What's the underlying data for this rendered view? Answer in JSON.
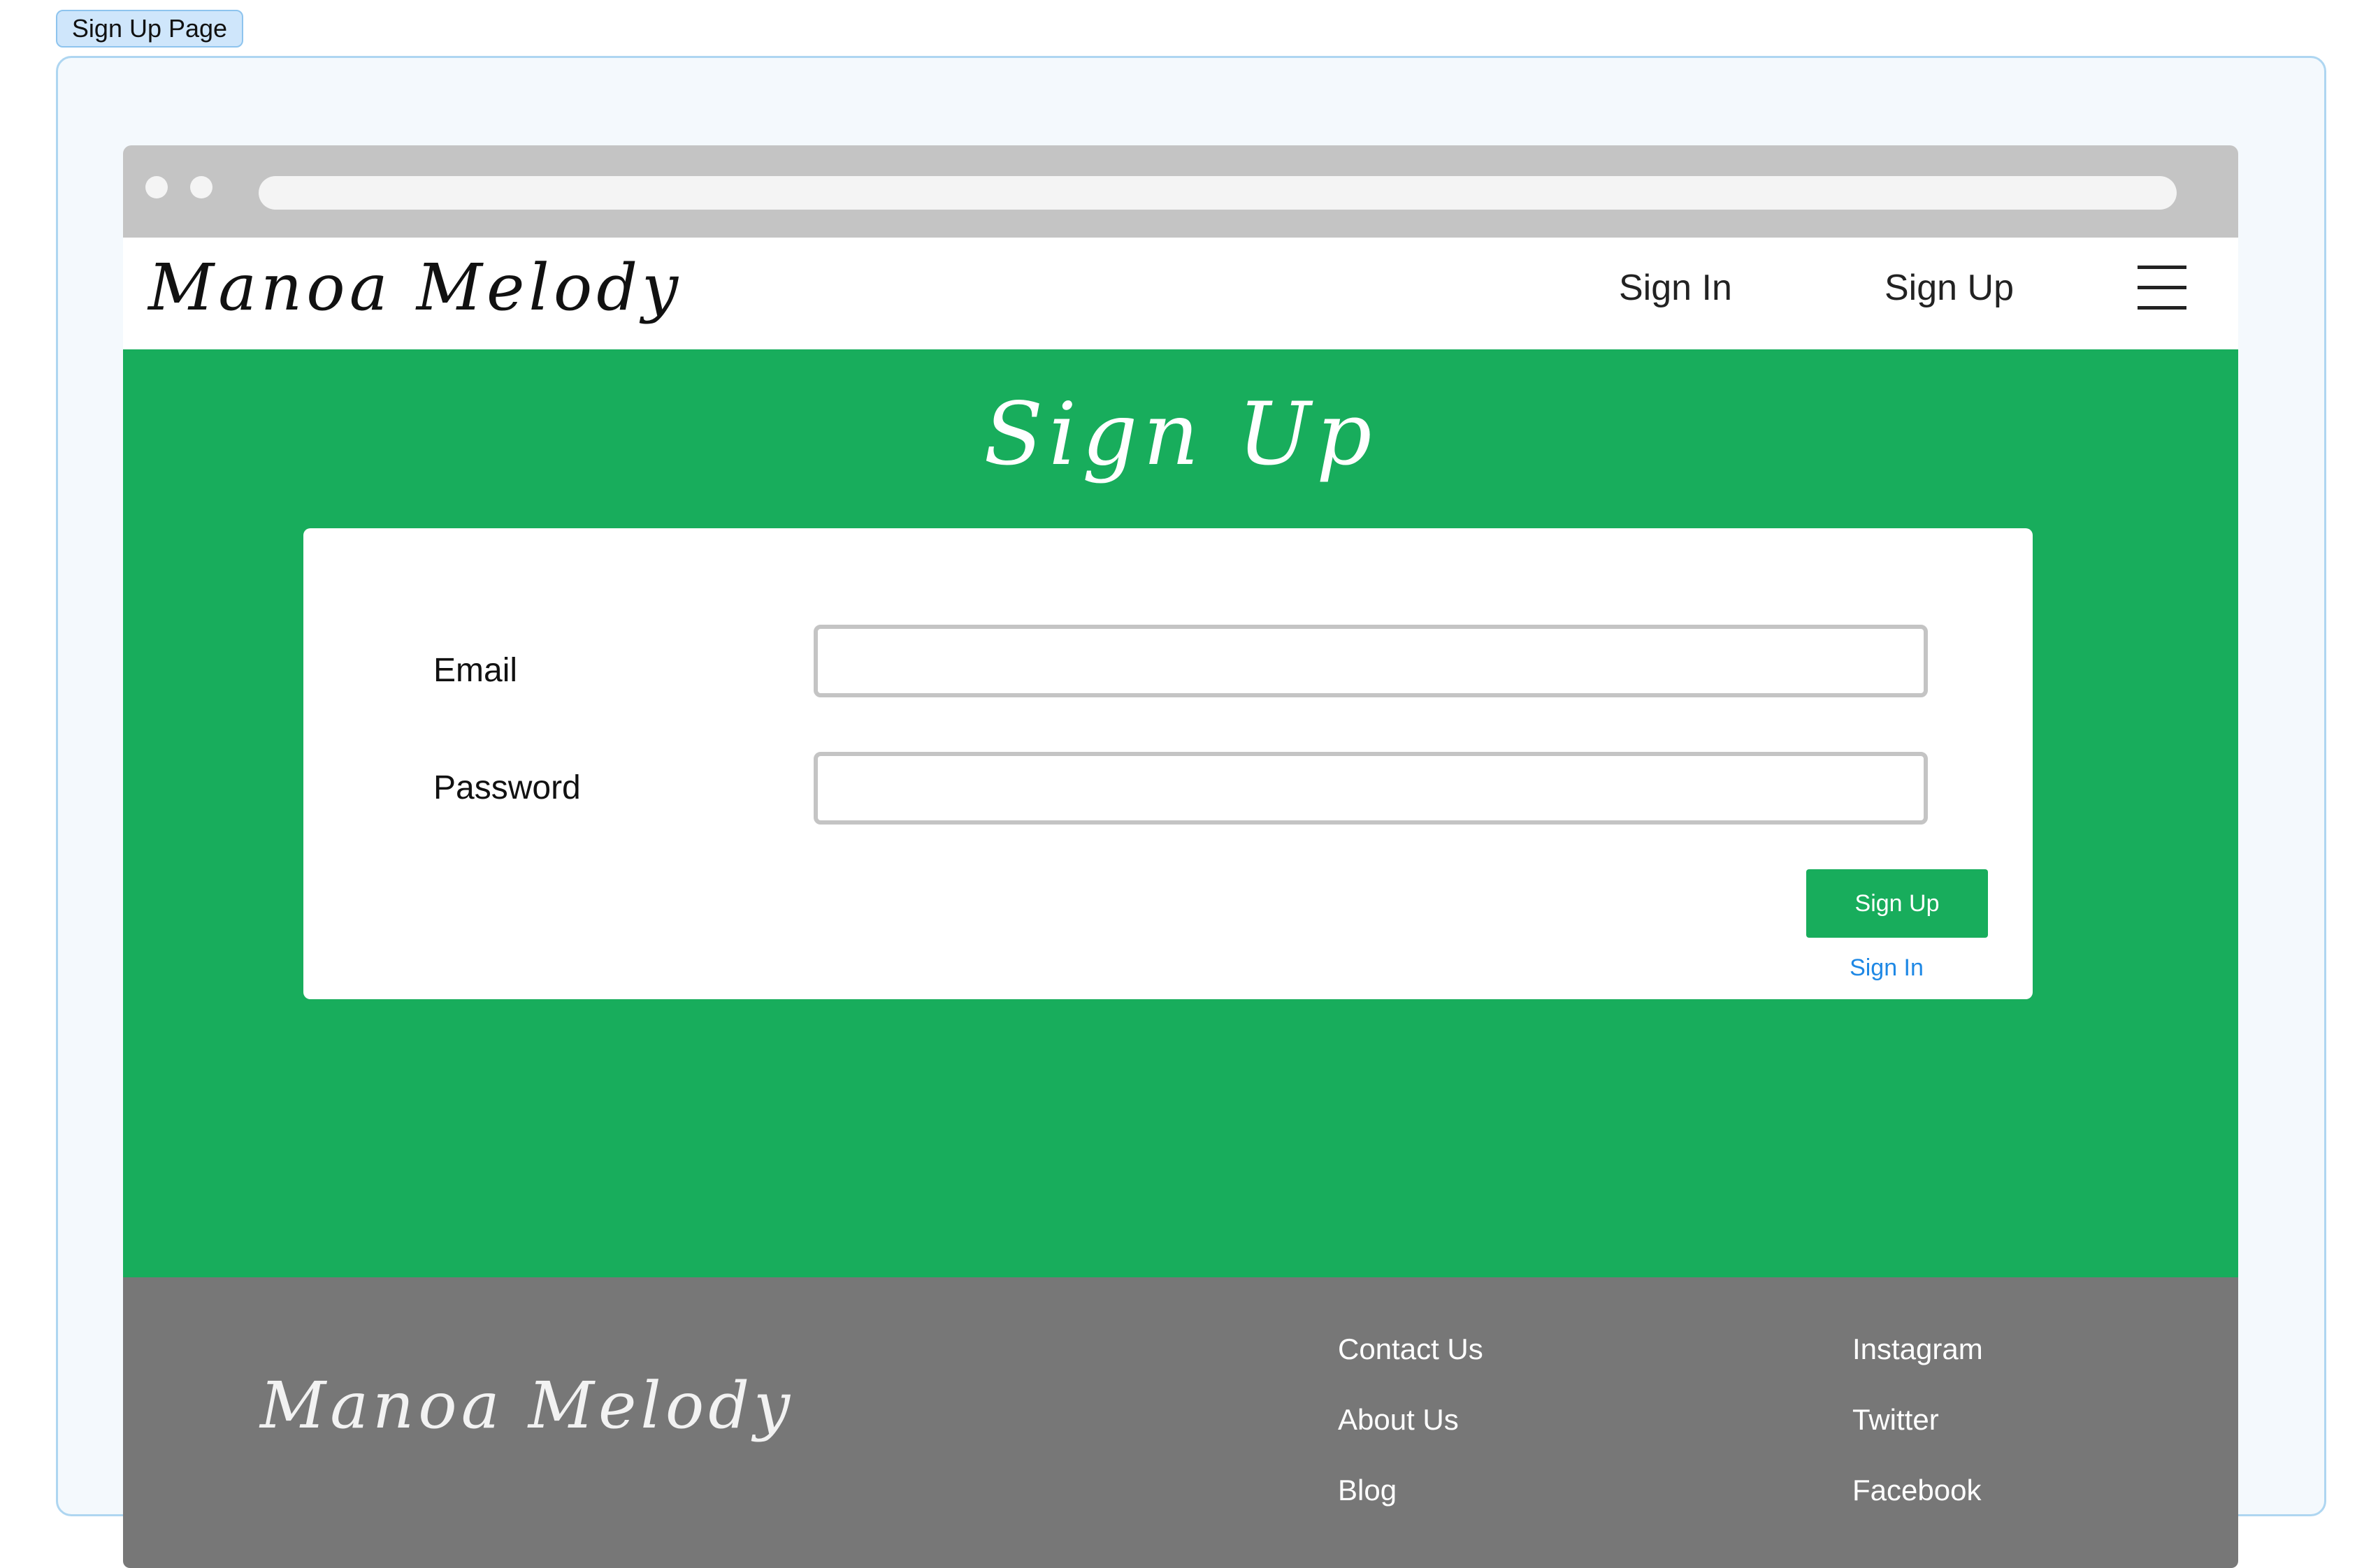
{
  "page_tag": "Sign Up Page",
  "colors": {
    "primary_green": "#18ad5c",
    "footer_gray": "#777777",
    "link_blue": "#1e88e5"
  },
  "navbar": {
    "logo": "Manoa Melody",
    "links": [
      "Sign In",
      "Sign Up"
    ],
    "menu_icon": "hamburger-menu-icon"
  },
  "hero": {
    "title": "Sign Up"
  },
  "form": {
    "email_label": "Email",
    "email_value": "",
    "password_label": "Password",
    "password_value": "",
    "submit_label": "Sign Up",
    "alt_link": "Sign In"
  },
  "footer": {
    "logo": "Manoa Melody",
    "column1": [
      "Contact Us",
      "About Us",
      "Blog"
    ],
    "column2": [
      "Instagram",
      "Twitter",
      "Facebook"
    ]
  }
}
